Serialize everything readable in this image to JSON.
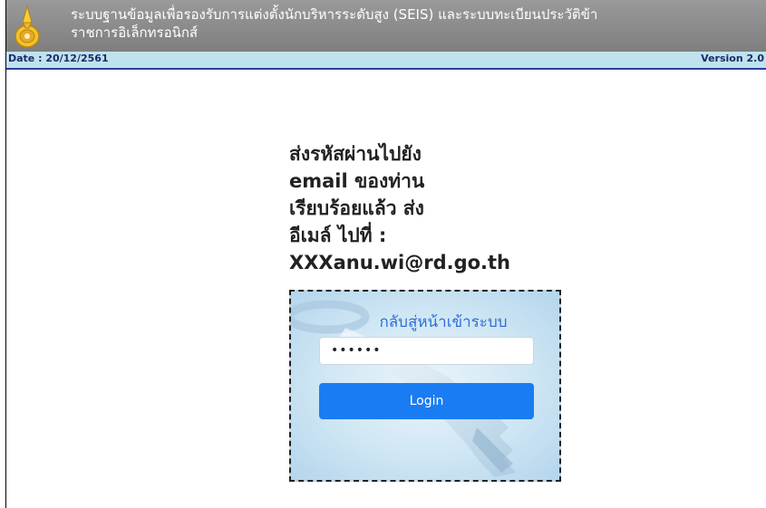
{
  "header": {
    "title_line1": "ระบบฐานข้อมูลเพื่อรองรับการแต่งตั้งนักบริหารระดับสูง (SEIS) และระบบทะเบียนประวัติข้า",
    "title_line2": "ราชการอิเล็กทรอนิกส์",
    "logo_icon": "government-seal-icon"
  },
  "info_bar": {
    "date": "Date : 20/12/2561",
    "version": "Version 2.0"
  },
  "message": {
    "lines": [
      "ส่งรหัสผ่านไปยัง",
      "email ของท่าน",
      "เรียบร้อยแล้ว ส่ง",
      "อีเมล์ ไปที่ :",
      "XXXanu.wi@rd.go.th"
    ]
  },
  "login_box": {
    "back_link": "กลับสู่หน้าเข้าระบบ",
    "password_value": "••••••",
    "login_label": "Login",
    "background_icon": "key-icon"
  },
  "colors": {
    "header_bg": "#8c8c8c",
    "info_bar_bg": "#bfe3ec",
    "info_bar_text": "#1b2a6b",
    "link": "#2e6fd6",
    "button": "#1a7cf2"
  }
}
